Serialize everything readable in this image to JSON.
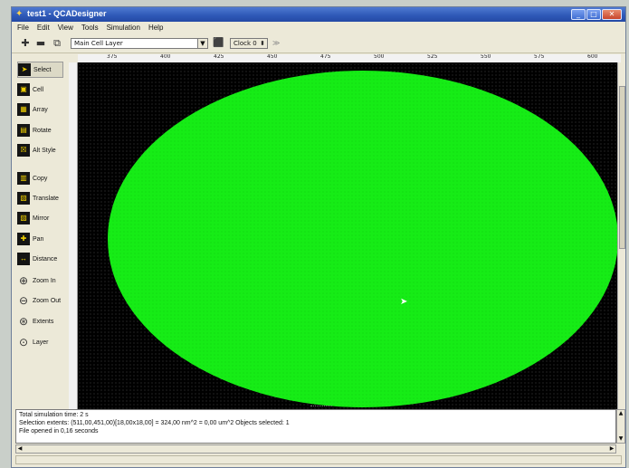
{
  "window": {
    "title": "test1 - QCADesigner"
  },
  "menu": [
    "File",
    "Edit",
    "View",
    "Tools",
    "Simulation",
    "Help"
  ],
  "toolbar": {
    "layer_value": "Main Cell Layer",
    "clock_value": "Clock 0"
  },
  "tools": [
    {
      "label": "Select",
      "icon": "pointer-icon",
      "active": true
    },
    {
      "label": "Cell",
      "icon": "cell-icon"
    },
    {
      "label": "Array",
      "icon": "array-icon"
    },
    {
      "label": "Rotate",
      "icon": "rotate-icon"
    },
    {
      "label": "Alt Style",
      "icon": "alt-style-icon"
    },
    {
      "label": "Copy",
      "icon": "copy-icon"
    },
    {
      "label": "Translate",
      "icon": "translate-icon"
    },
    {
      "label": "Mirror",
      "icon": "mirror-icon"
    },
    {
      "label": "Pan",
      "icon": "pan-icon"
    },
    {
      "label": "Distance",
      "icon": "distance-icon"
    },
    {
      "label": "Zoom In",
      "icon": "zoom-in-icon"
    },
    {
      "label": "Zoom Out",
      "icon": "zoom-out-icon"
    },
    {
      "label": "Extents",
      "icon": "extents-icon"
    },
    {
      "label": "Layer",
      "icon": "layer-icon"
    }
  ],
  "ruler": {
    "labels": [
      "375",
      "400",
      "425",
      "450",
      "475",
      "500",
      "525",
      "550",
      "575",
      "600"
    ]
  },
  "canvas": {
    "object_color": "#16ec16",
    "background": "#000000"
  },
  "messages": [
    "Total simulation time: 2 s",
    "Selection extents: (511,00,451,00)[18,00x18,00] = 324,00 nm^2 = 0,00 um^2 Objects selected: 1",
    "File opened in 0,16 seconds"
  ]
}
